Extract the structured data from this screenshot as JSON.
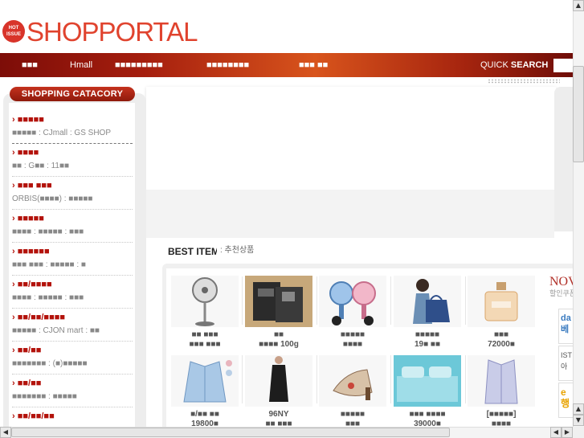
{
  "header": {
    "hot_badge": "HOT ISSUE",
    "logo": "SHOPPORTAL",
    "nav": [
      {
        "label": "■■■"
      },
      {
        "label": "Hmall"
      },
      {
        "label": "■■■■■■■■■"
      },
      {
        "label": "■■■■■■■■"
      },
      {
        "label": "■■■ ■■"
      }
    ],
    "quick_search_prefix": "QUICK ",
    "quick_search_bold": "SEARCH",
    "quick_search_value": ""
  },
  "sidebar": {
    "title": "SHOPPING CATACORY",
    "categories": [
      {
        "title": "■■■■■",
        "sub": "■■■■■ : CJmall : GS SHOP"
      },
      {
        "title": "■■■■",
        "sub": "■■ : G■■ : 11■■"
      },
      {
        "title": "■■■ ■■■",
        "sub": "ORBIS(■■■■) : ■■■■■"
      },
      {
        "title": "■■■■■",
        "sub": "■■■■ : ■■■■■ : ■■■"
      },
      {
        "title": "■■■■■■",
        "sub": "■■■ ■■■ : ■■■■■ : ■"
      },
      {
        "title": "■■/■■■■",
        "sub": "■■■■ : ■■■■■ : ■■■"
      },
      {
        "title": "■■/■■/■■■■",
        "sub": "■■■■■ : CJON mart : ■■"
      },
      {
        "title": "■■/■■",
        "sub": "■■■■■■■ : (■)■■■■■"
      },
      {
        "title": "■■/■■",
        "sub": "■■■■■■■ : ■■■■■"
      },
      {
        "title": "■■/■■/■■",
        "sub": "■■■ : ■■■■■■■■ : ■■"
      }
    ]
  },
  "best": {
    "title": "BEST ITEM",
    "subtitle": ": 추천상품",
    "products": [
      {
        "name": "■■ ■■■",
        "price": "■■■ ■■■",
        "icon": "fan-icon"
      },
      {
        "name": "■■",
        "price": "■■■■ 100g",
        "icon": "product-box-icon"
      },
      {
        "name": "■■■■■",
        "price": "■■■■",
        "icon": "mini-fans-icon"
      },
      {
        "name": "■■■■■",
        "price": "19■ ■■",
        "icon": "model-bag-icon"
      },
      {
        "name": "■■■",
        "price": "72000■",
        "icon": "perfume-icon"
      },
      {
        "name": "■/■■ ■■",
        "price": "19800■",
        "icon": "jacket-icon"
      },
      {
        "name": "96NY",
        "price": "■■ ■■■",
        "icon": "dress-icon"
      },
      {
        "name": "■■■■■",
        "price": "■■■",
        "icon": "sandal-icon"
      },
      {
        "name": "■■■ ■■■■",
        "price": "39000■",
        "icon": "bedding-icon"
      },
      {
        "name": "[■■■■■]",
        "price": "■■■■",
        "icon": "shirt-icon"
      }
    ]
  },
  "side_promo": {
    "now": "NOV",
    "sub": "할인쿠폰",
    "cards": [
      "da 베",
      "IST 아",
      "e 행"
    ]
  },
  "colors": {
    "brand": "#e0432e",
    "nav_dark": "#7d0d08",
    "nav_light": "#d8541c",
    "category_red": "#b3120b"
  }
}
